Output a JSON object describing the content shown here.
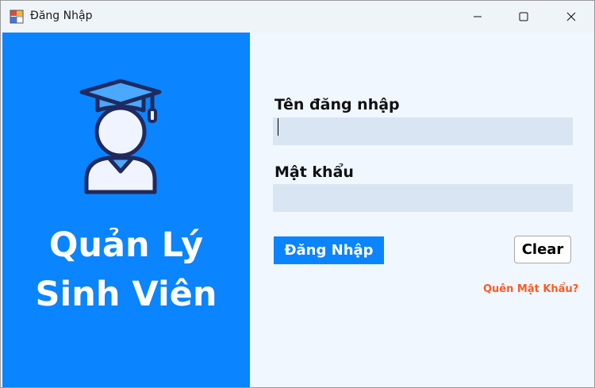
{
  "window": {
    "title": "Đăng Nhập",
    "controls": [
      "minimize",
      "maximize",
      "close"
    ]
  },
  "left_panel": {
    "icon": "graduate-student-icon",
    "title_line1": "Quản Lý",
    "title_line2": "Sinh Viên",
    "color": "#0a84ff"
  },
  "form": {
    "username_label": "Tên đăng nhập",
    "username_value": "",
    "password_label": "Mật khẩu",
    "password_value": "",
    "login_button": "Đăng Nhập",
    "clear_button": "Clear",
    "forgot_link": "Quên Mật Khẩu?",
    "link_color": "#ff5a1f",
    "input_bg": "#d9e5f2"
  }
}
